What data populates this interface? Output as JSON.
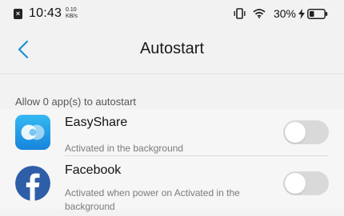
{
  "status_bar": {
    "notification_icon": "x-box-icon",
    "time": "10:43",
    "net_speed_value": "0.10",
    "net_speed_unit": "KB/s",
    "battery_percent": "30%",
    "icons": [
      "vibrate-icon",
      "wifi-icon",
      "charging-bolt-icon",
      "battery-icon"
    ]
  },
  "header": {
    "title": "Autostart",
    "back_icon": "chevron-left-icon"
  },
  "section": {
    "label": "Allow 0 app(s) to autostart"
  },
  "apps": [
    {
      "name": "EasyShare",
      "description": "Activated in the background",
      "icon": "easyshare-icon",
      "enabled": false
    },
    {
      "name": "Facebook",
      "description": "Activated when power on  Activated in the background",
      "icon": "facebook-icon",
      "enabled": false
    }
  ],
  "colors": {
    "accent": "#1a8fd6",
    "background": "#f2f2f2",
    "toggle_off": "#d9d9d9",
    "facebook_blue": "#2f5ea8",
    "easyshare_blue": "#1e9be8",
    "battery_level": "30%"
  }
}
